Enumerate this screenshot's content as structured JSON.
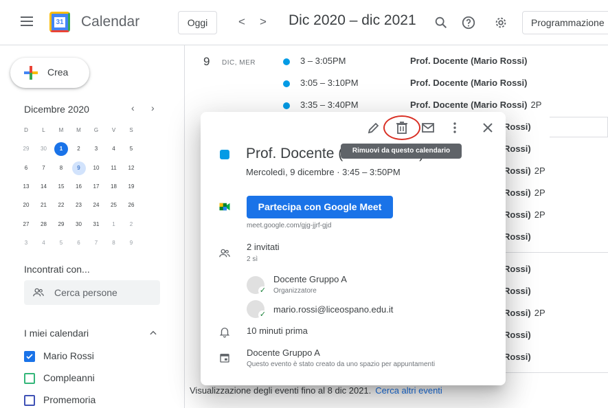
{
  "header": {
    "app_name": "Calendar",
    "today_label": "Oggi",
    "prev_glyph": "<",
    "next_glyph": ">",
    "range_title": "Dic 2020 – dic 2021",
    "view_label": "Programmazione"
  },
  "sidebar": {
    "create_label": "Crea",
    "month_title": "Dicembre 2020",
    "weekdays": [
      "D",
      "L",
      "M",
      "M",
      "G",
      "V",
      "S"
    ],
    "weeks": [
      [
        "29",
        "30",
        "1",
        "2",
        "3",
        "4",
        "5"
      ],
      [
        "6",
        "7",
        "8",
        "9",
        "10",
        "11",
        "12"
      ],
      [
        "13",
        "14",
        "15",
        "16",
        "17",
        "18",
        "19"
      ],
      [
        "20",
        "21",
        "22",
        "23",
        "24",
        "25",
        "26"
      ],
      [
        "27",
        "28",
        "29",
        "30",
        "31",
        "1",
        "2"
      ],
      [
        "3",
        "4",
        "5",
        "6",
        "7",
        "8",
        "9"
      ]
    ],
    "meet_with_title": "Incontrati con...",
    "search_people_placeholder": "Cerca persone",
    "my_calendars_title": "I miei calendari",
    "calendars": [
      {
        "label": "Mario Rossi",
        "checked": true,
        "color": "#1a73e8"
      },
      {
        "label": "Compleanni",
        "checked": false,
        "color": "#33b679"
      },
      {
        "label": "Promemoria",
        "checked": false,
        "color": "#3f51b5"
      }
    ]
  },
  "agenda": {
    "day_number": "9",
    "day_label": "DIC, MER",
    "events": [
      {
        "time": "3 – 3:05PM",
        "title": "Prof. Docente (Mario Rossi)",
        "suffix": ""
      },
      {
        "time": "3:05 – 3:10PM",
        "title": "Prof. Docente (Mario Rossi)",
        "suffix": ""
      },
      {
        "time": "3:35 – 3:40PM",
        "title": "Prof. Docente (Mario Rossi)",
        "suffix": "2P"
      }
    ],
    "hidden_rows": [
      {
        "text": "Rossi)",
        "suffix": ""
      },
      {
        "text": "Rossi)",
        "suffix": ""
      },
      {
        "text": "Rossi)",
        "suffix": "2P"
      },
      {
        "text": "Rossi)",
        "suffix": "2P"
      },
      {
        "text": "Rossi)",
        "suffix": "2P"
      },
      {
        "text": "Rossi)",
        "suffix": ""
      },
      {
        "text": "Rossi)",
        "suffix": ""
      },
      {
        "text": "Rossi)",
        "suffix": ""
      },
      {
        "text": "Rossi)",
        "suffix": "2P"
      },
      {
        "text": "Rossi)",
        "suffix": ""
      },
      {
        "text": "Rossi)",
        "suffix": ""
      }
    ],
    "footer_text": "Visualizzazione degli eventi fino al 8 dic 2021.",
    "footer_link": "Cerca altri eventi"
  },
  "popup": {
    "tooltip": "Rimuovi da questo calendario",
    "title": "Prof. Docente (Mario Rossi)",
    "when": "Mercoledì, 9 dicembre  ·  3:45 – 3:50PM",
    "meet_button": "Partecipa con Google Meet",
    "meet_link": "meet.google.com/gjg-jjrf-gjd",
    "guests_count": "2 invitati",
    "guests_yes": "2 sì",
    "guests": [
      {
        "name": "Docente Gruppo A",
        "role": "Organizzatore"
      },
      {
        "name": "mario.rossi@liceospano.edu.it",
        "role": ""
      }
    ],
    "reminder": "10 minuti prima",
    "calendar_name": "Docente Gruppo A",
    "calendar_note": "Questo evento è stato creato da uno spazio per appuntamenti"
  },
  "colors": {
    "accent": "#1a73e8",
    "event": "#039be5",
    "highlight_circle": "#d93025"
  }
}
